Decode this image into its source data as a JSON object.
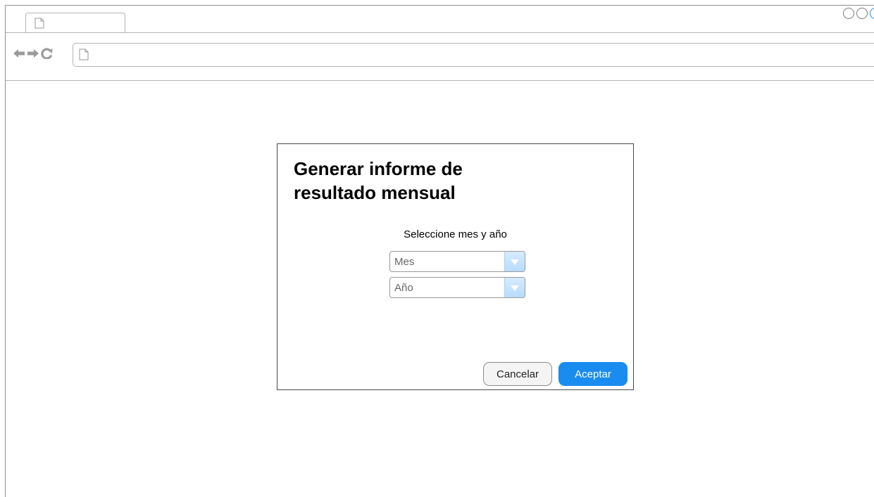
{
  "browser": {
    "address_value": ""
  },
  "dialog": {
    "title": "Generar informe de resultado mensual",
    "prompt": "Seleccione mes y año",
    "month_select": {
      "selected": "Mes"
    },
    "year_select": {
      "selected": "Año"
    },
    "cancel_label": "Cancelar",
    "accept_label": "Aceptar"
  },
  "colors": {
    "accent": "#1a8cf0",
    "border": "#4a4a4a",
    "chrome_lines": "#b4b4b4"
  },
  "icons": [
    "page-icon",
    "back-arrow-icon",
    "forward-arrow-icon",
    "reload-icon"
  ]
}
